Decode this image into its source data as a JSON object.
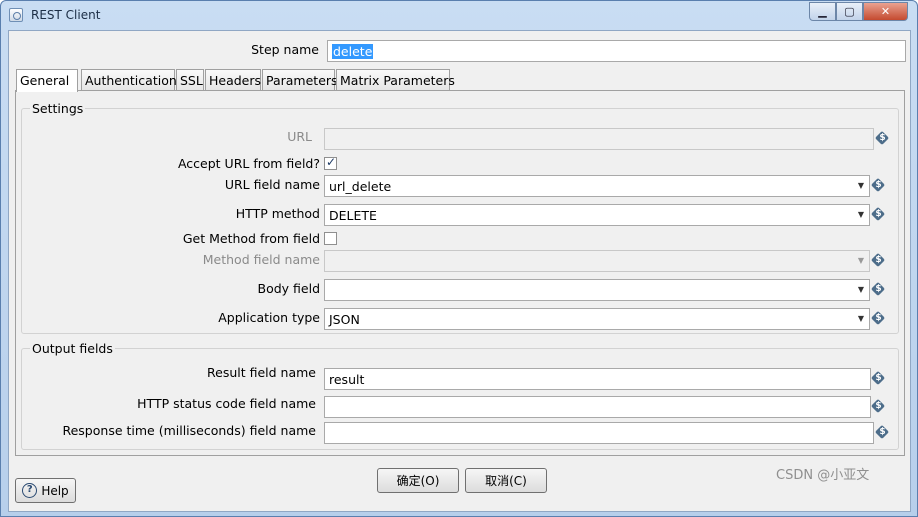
{
  "window": {
    "title": "REST Client"
  },
  "step": {
    "label": "Step name",
    "value": "delete"
  },
  "tabs": [
    {
      "label": "General"
    },
    {
      "label": "Authentication"
    },
    {
      "label": "SSL"
    },
    {
      "label": "Headers"
    },
    {
      "label": "Parameters"
    },
    {
      "label": "Matrix Parameters"
    }
  ],
  "settings": {
    "title": "Settings",
    "url": {
      "label": "URL",
      "value": ""
    },
    "accept_url": {
      "label": "Accept URL from field?",
      "checked": true
    },
    "url_field_name": {
      "label": "URL field name",
      "value": "url_delete"
    },
    "http_method": {
      "label": "HTTP method",
      "value": "DELETE"
    },
    "get_method_from_field": {
      "label": "Get Method from field",
      "checked": false
    },
    "method_field_name": {
      "label": "Method field name",
      "value": ""
    },
    "body_field": {
      "label": "Body field",
      "value": ""
    },
    "application_type": {
      "label": "Application type",
      "value": "JSON"
    }
  },
  "output": {
    "title": "Output fields",
    "result_field_name": {
      "label": "Result field name",
      "value": "result"
    },
    "http_status_code_field_name": {
      "label": "HTTP status code field name",
      "value": ""
    },
    "response_time_field_name": {
      "label": "Response time (milliseconds) field name",
      "value": ""
    }
  },
  "buttons": {
    "ok": "确定(O)",
    "cancel": "取消(C)",
    "help": "Help"
  },
  "watermark": "CSDN @小亚文"
}
